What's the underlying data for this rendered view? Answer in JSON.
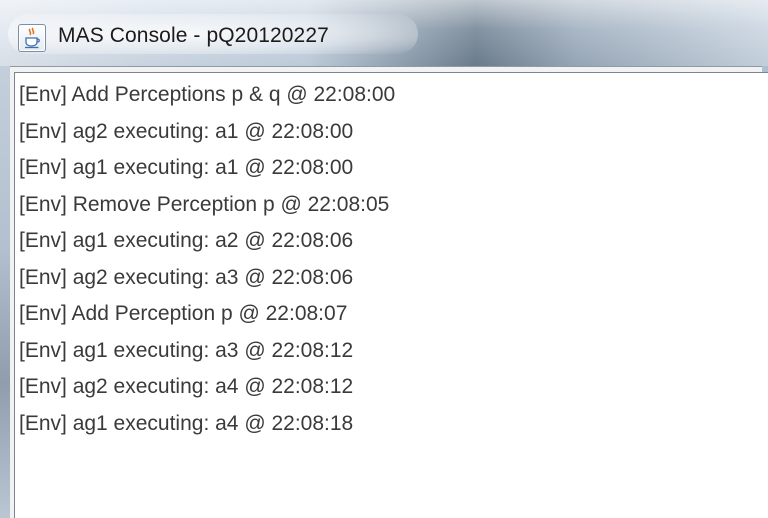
{
  "window": {
    "title": "MAS Console - pQ20120227",
    "icon": "java-cup-icon"
  },
  "console": {
    "lines": [
      "[Env] Add Perceptions p & q @ 22:08:00",
      "[Env] ag2 executing: a1 @ 22:08:00",
      "[Env] ag1 executing: a1 @ 22:08:00",
      "[Env] Remove Perception p @ 22:08:05",
      "[Env] ag1 executing: a2 @ 22:08:06",
      "[Env] ag2 executing: a3 @ 22:08:06",
      "[Env] Add Perception p @ 22:08:07",
      "[Env] ag1 executing: a3 @ 22:08:12",
      "[Env] ag2 executing: a4 @ 22:08:12",
      "[Env] ag1 executing: a4 @ 22:08:18"
    ]
  },
  "colors": {
    "text": "#3a3a3a",
    "background": "#ffffff",
    "title_text": "#1b1b1b"
  }
}
